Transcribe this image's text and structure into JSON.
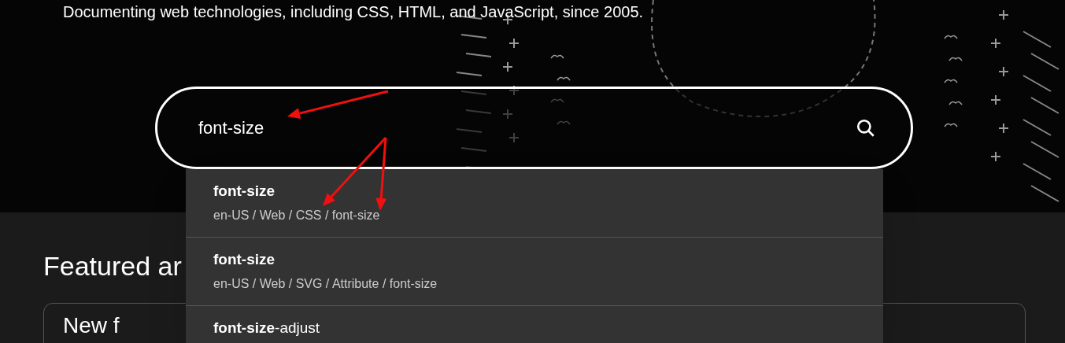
{
  "hero": {
    "tagline": "Documenting web technologies, including CSS, HTML, and JavaScript, since 2005."
  },
  "search": {
    "value": "font-size"
  },
  "results": [
    {
      "match": "font-size",
      "path": "en-US / Web / CSS / font-size"
    },
    {
      "match": "font-size",
      "path": "en-US / Web / SVG / Attribute / font-size"
    },
    {
      "match": "font-size",
      "rest": "-adjust"
    }
  ],
  "featured": {
    "heading": "Featured ar",
    "card_title": "New f"
  }
}
